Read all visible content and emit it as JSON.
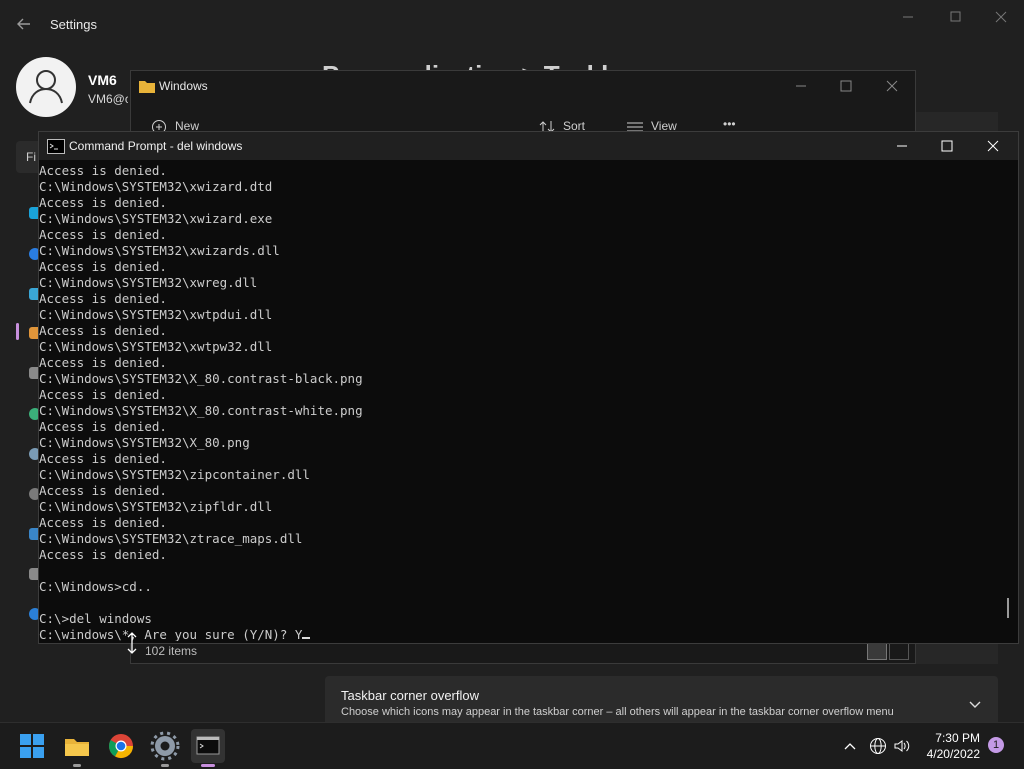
{
  "settings": {
    "title": "Settings",
    "user": {
      "name": "VM6",
      "email": "VM6@c"
    },
    "find_placeholder": "Fi",
    "page_heading": "Personalization > Taskbar",
    "corner_overflow": {
      "title": "Taskbar corner overflow",
      "description": "Choose which icons may appear in the taskbar corner – all others will appear in the taskbar corner overflow menu"
    }
  },
  "explorer": {
    "title": "Windows",
    "toolbar": {
      "new": "New",
      "sort": "Sort",
      "view": "View",
      "more": "•••"
    },
    "status": "102 items"
  },
  "cmd": {
    "title": "Command Prompt - del  windows",
    "output": "Access is denied.\nC:\\Windows\\SYSTEM32\\xwizard.dtd\nAccess is denied.\nC:\\Windows\\SYSTEM32\\xwizard.exe\nAccess is denied.\nC:\\Windows\\SYSTEM32\\xwizards.dll\nAccess is denied.\nC:\\Windows\\SYSTEM32\\xwreg.dll\nAccess is denied.\nC:\\Windows\\SYSTEM32\\xwtpdui.dll\nAccess is denied.\nC:\\Windows\\SYSTEM32\\xwtpw32.dll\nAccess is denied.\nC:\\Windows\\SYSTEM32\\X_80.contrast-black.png\nAccess is denied.\nC:\\Windows\\SYSTEM32\\X_80.contrast-white.png\nAccess is denied.\nC:\\Windows\\SYSTEM32\\X_80.png\nAccess is denied.\nC:\\Windows\\SYSTEM32\\zipcontainer.dll\nAccess is denied.\nC:\\Windows\\SYSTEM32\\zipfldr.dll\nAccess is denied.\nC:\\Windows\\SYSTEM32\\ztrace_maps.dll\nAccess is denied.\n\nC:\\Windows>cd..\n\nC:\\>del windows\n",
    "prompt_line": "C:\\windows\\*, Are you sure (Y/N)? Y"
  },
  "taskbar": {
    "time": "7:30 PM",
    "date": "4/20/2022",
    "notification_count": "1",
    "icons": [
      "start-icon",
      "file-explorer-icon",
      "chrome-icon",
      "settings-icon",
      "terminal-icon"
    ]
  },
  "colors": {
    "accent": "#c78fdd",
    "console_bg": "#0c0c0c",
    "console_text": "#cccccc",
    "chrome_blue": "#1a73e8"
  }
}
